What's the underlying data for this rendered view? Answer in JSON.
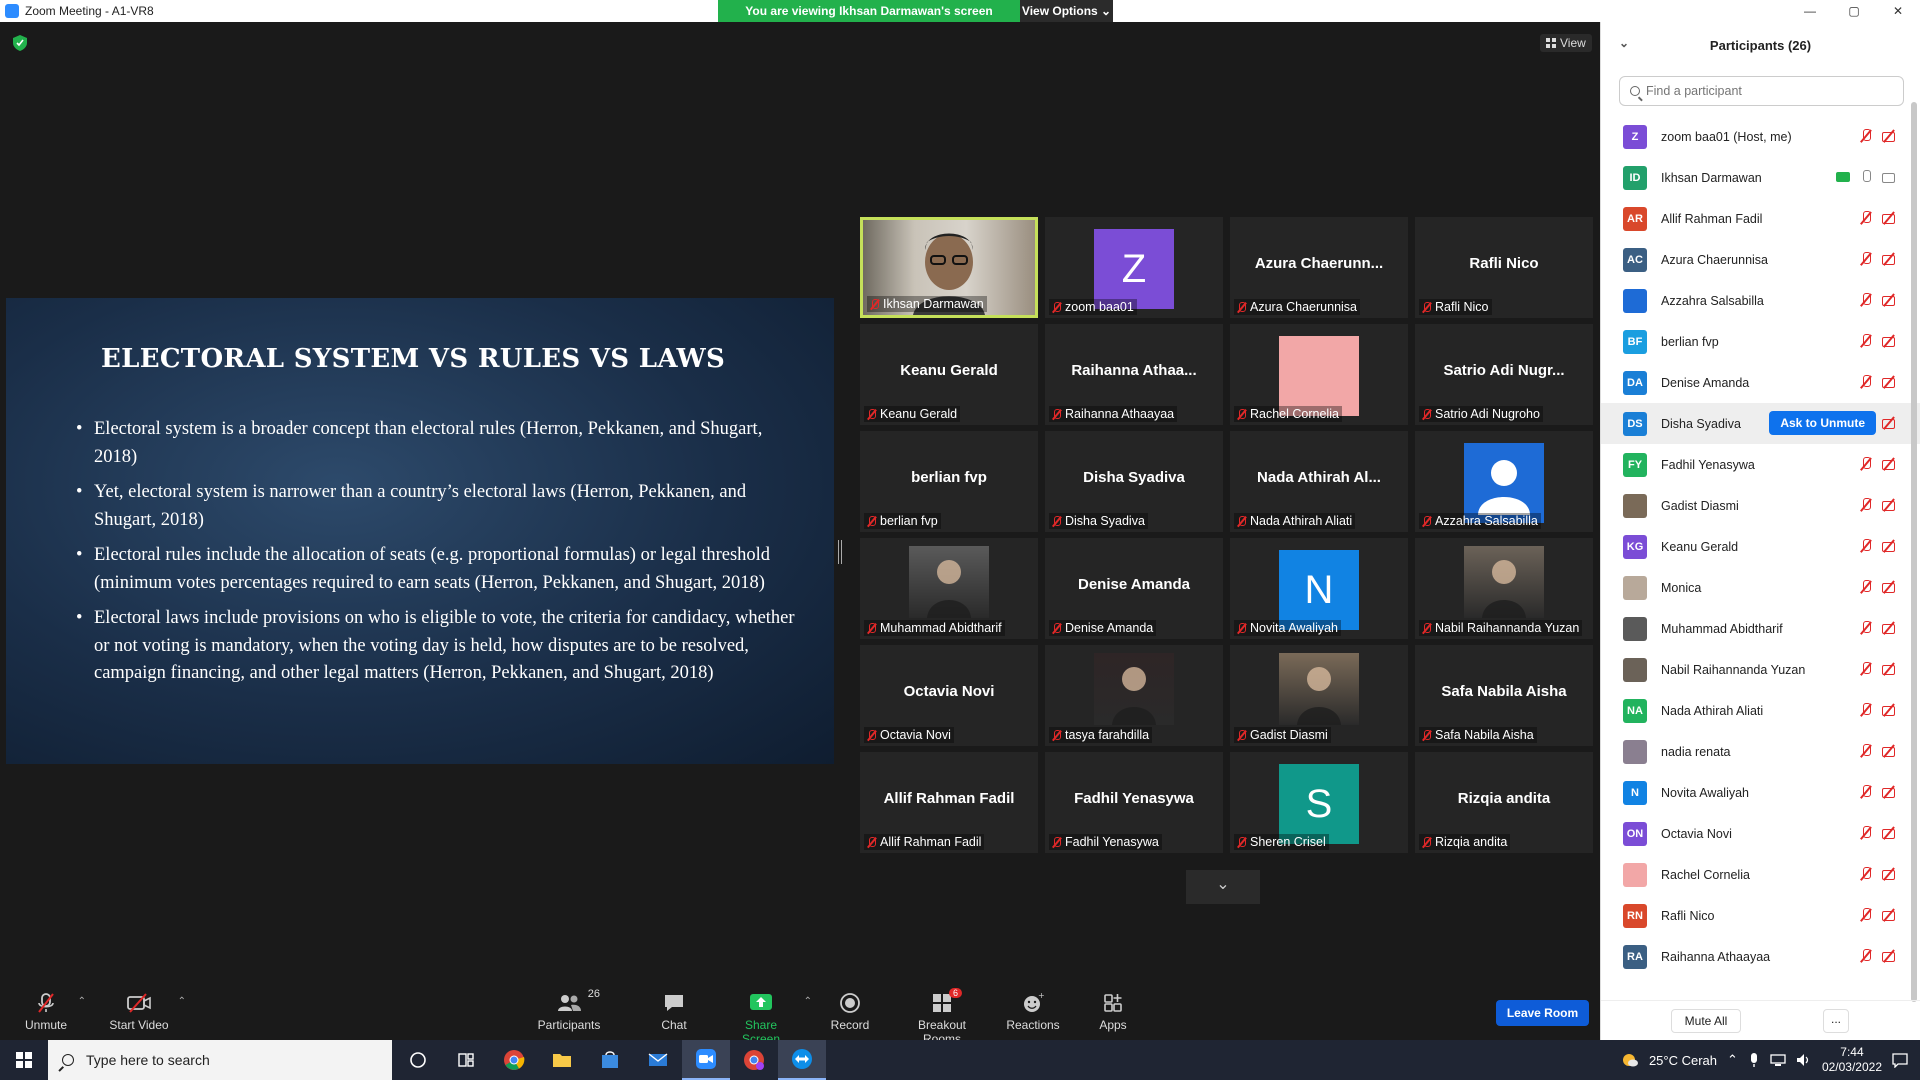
{
  "window": {
    "title": "Zoom Meeting - A1-VR8",
    "min": "—",
    "max": "▢",
    "close": "✕"
  },
  "share_banner": {
    "text": "You are viewing Ikhsan Darmawan's screen",
    "view_options": "View Options ⌄"
  },
  "view_button": "View",
  "slide": {
    "title": "ELECTORAL SYSTEM VS RULES VS LAWS",
    "bullets": [
      "Electoral system is a broader concept than electoral rules (Herron, Pekkanen, and Shugart, 2018)",
      "Yet, electoral system is narrower than a country’s electoral laws (Herron, Pekkanen, and Shugart, 2018)",
      "Electoral rules include the allocation of seats (e.g. proportional formulas) or legal threshold (minimum votes percentages required to earn seats (Herron, Pekkanen, and Shugart, 2018)",
      "Electoral laws include provisions on who is eligible to vote, the criteria for candidacy, whether or not voting is mandatory, when the voting day is held, how disputes are to be resolved, campaign financing, and other legal matters (Herron, Pekkanen, and Shugart, 2018)"
    ]
  },
  "tiles": [
    {
      "big": "",
      "label": "Ikhsan Darmawan",
      "kind": "photo",
      "color": "#8a7a6a"
    },
    {
      "big": "",
      "label": "zoom baa01",
      "kind": "letter",
      "letter": "Z",
      "color": "#7b4dd6"
    },
    {
      "big": "Azura  Chaerunn...",
      "label": "Azura Chaerunnisa",
      "kind": "name"
    },
    {
      "big": "Rafli Nico",
      "label": "Rafli Nico",
      "kind": "name"
    },
    {
      "big": "Keanu Gerald",
      "label": "Keanu Gerald",
      "kind": "name"
    },
    {
      "big": "Raihanna  Athaa...",
      "label": "Raihanna Athaayaa",
      "kind": "name"
    },
    {
      "big": "",
      "label": "Rachel Cornelia",
      "kind": "swatch",
      "color": "#f2a7a7"
    },
    {
      "big": "Satrio Adi Nugr...",
      "label": "Satrio Adi Nugroho",
      "kind": "name"
    },
    {
      "big": "berlian fvp",
      "label": "berlian fvp",
      "kind": "name"
    },
    {
      "big": "Disha Syadiva",
      "label": "Disha Syadiva",
      "kind": "name"
    },
    {
      "big": "Nada Athirah Al...",
      "label": "Nada Athirah Aliati",
      "kind": "name"
    },
    {
      "big": "",
      "label": "Azzahra Salsabilla",
      "kind": "person",
      "color": "#1e6bd6"
    },
    {
      "big": "",
      "label": "Muhammad Abidtharif",
      "kind": "photo",
      "color": "#5a5a5a"
    },
    {
      "big": "Denise Amanda",
      "label": "Denise Amanda",
      "kind": "name"
    },
    {
      "big": "",
      "label": "Novita Awaliyah",
      "kind": "letter",
      "letter": "N",
      "color": "#1183e3"
    },
    {
      "big": "",
      "label": "Nabil Raihannanda Yuzan",
      "kind": "photo",
      "color": "#6b6258"
    },
    {
      "big": "Octavia Novi",
      "label": "Octavia Novi",
      "kind": "name"
    },
    {
      "big": "",
      "label": "tasya farahdilla",
      "kind": "photo",
      "color": "#2e2526"
    },
    {
      "big": "",
      "label": "Gadist Diasmi",
      "kind": "photo",
      "color": "#7a6a58"
    },
    {
      "big": "Safa Nabila Aisha",
      "label": "Safa Nabila Aisha",
      "kind": "name"
    },
    {
      "big": "Allif Rahman Fadil",
      "label": "Allif Rahman Fadil",
      "kind": "name"
    },
    {
      "big": "Fadhil Yenasywa",
      "label": "Fadhil Yenasywa",
      "kind": "name"
    },
    {
      "big": "",
      "label": "Sheren Crisel",
      "kind": "letter",
      "letter": "S",
      "color": "#10988a"
    },
    {
      "big": "Rizqia andita",
      "label": "Rizqia andita",
      "kind": "name"
    }
  ],
  "more_tiles": "⌄",
  "toolbar": {
    "unmute": "Unmute",
    "start_video": "Start Video",
    "participants": "Participants",
    "participants_count": "26",
    "chat": "Chat",
    "share_screen": "Share Screen",
    "record": "Record",
    "breakout": "Breakout Rooms",
    "breakout_badge": "6",
    "reactions": "Reactions",
    "apps": "Apps",
    "leave": "Leave Room"
  },
  "panel": {
    "title": "Participants (26)",
    "collapse": "⌄",
    "search_placeholder": "Find a participant",
    "ask_to_unmute": "Ask to Unmute",
    "mute_all": "Mute All",
    "more": "...",
    "participants": [
      {
        "initials": "Z",
        "name": "zoom baa01 (Host, me)",
        "color": "#7b4dd6"
      },
      {
        "initials": "ID",
        "name": "Ikhsan Darmawan",
        "color": "#22a06b",
        "sharing": true
      },
      {
        "initials": "AR",
        "name": "Allif Rahman Fadil",
        "color": "#d9482b"
      },
      {
        "initials": "AC",
        "name": "Azura Chaerunnisa",
        "color": "#3b5f83"
      },
      {
        "initials": "",
        "name": "Azzahra Salsabilla",
        "color": "#1e6bd6"
      },
      {
        "initials": "BF",
        "name": "berlian fvp",
        "color": "#1a9ee0"
      },
      {
        "initials": "DA",
        "name": "Denise Amanda",
        "color": "#1a7fd6"
      },
      {
        "initials": "DS",
        "name": "Disha Syadiva",
        "color": "#1a7fd6",
        "ask": true
      },
      {
        "initials": "FY",
        "name": "Fadhil Yenasywa",
        "color": "#22b35e"
      },
      {
        "initials": "",
        "name": "Gadist Diasmi",
        "color": "#7a6a58"
      },
      {
        "initials": "KG",
        "name": "Keanu Gerald",
        "color": "#7b4dd6"
      },
      {
        "initials": "",
        "name": "Monica",
        "color": "#b8a99a"
      },
      {
        "initials": "",
        "name": "Muhammad Abidtharif",
        "color": "#5a5a5a"
      },
      {
        "initials": "",
        "name": "Nabil Raihannanda Yuzan",
        "color": "#6b6258"
      },
      {
        "initials": "NA",
        "name": "Nada Athirah Aliati",
        "color": "#22b35e"
      },
      {
        "initials": "",
        "name": "nadia renata",
        "color": "#8a7f90"
      },
      {
        "initials": "N",
        "name": "Novita Awaliyah",
        "color": "#1183e3"
      },
      {
        "initials": "ON",
        "name": "Octavia Novi",
        "color": "#7b4dd6"
      },
      {
        "initials": "",
        "name": "Rachel Cornelia",
        "color": "#f2a7a7"
      },
      {
        "initials": "RN",
        "name": "Rafli Nico",
        "color": "#d9482b"
      },
      {
        "initials": "RA",
        "name": "Raihanna Athaayaa",
        "color": "#3b5f83"
      }
    ]
  },
  "taskbar": {
    "search_placeholder": "Type here to search",
    "weather": "25°C  Cerah",
    "time": "7:44",
    "date": "02/03/2022"
  }
}
